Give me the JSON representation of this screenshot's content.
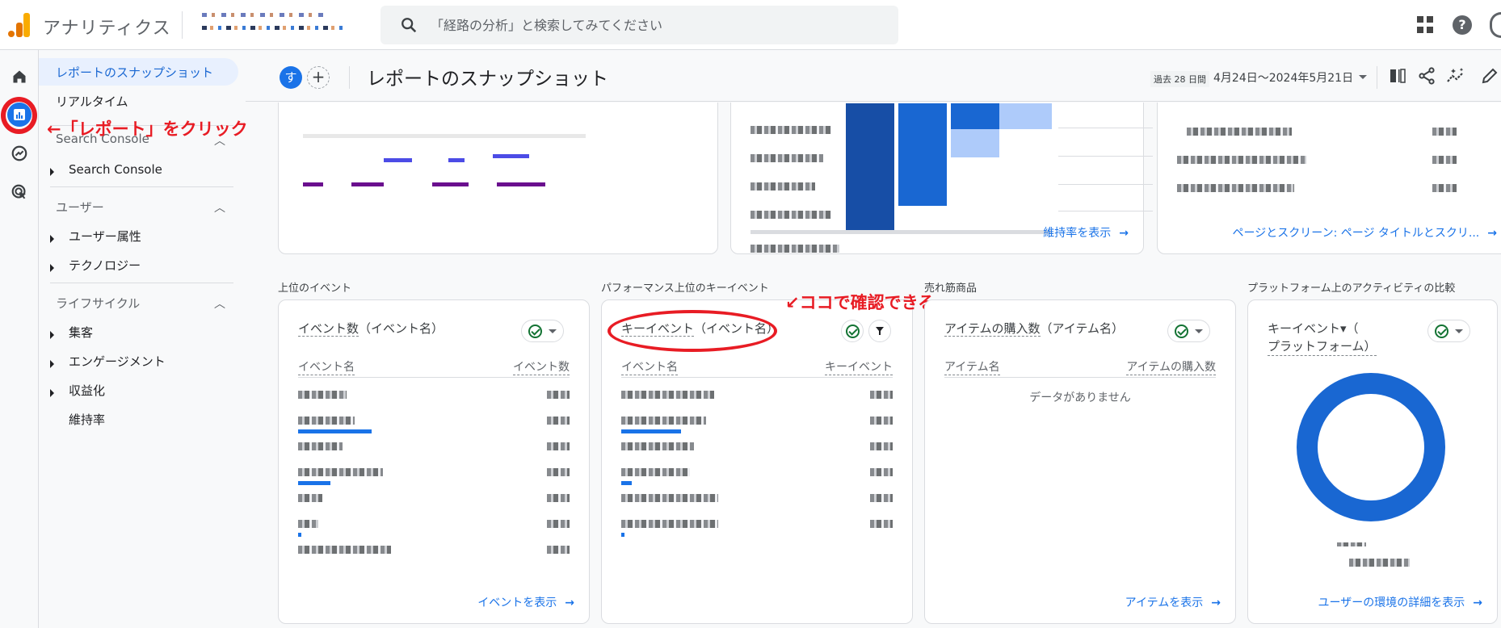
{
  "header": {
    "app_name": "アナリティクス",
    "search_placeholder": "「経路の分析」と検索してみてください",
    "icons": [
      "apps-icon",
      "help-icon",
      "account-icon"
    ]
  },
  "rail": {
    "items": [
      {
        "name": "home",
        "icon": "home-icon"
      },
      {
        "name": "reports",
        "icon": "bar-chart-icon",
        "active": true
      },
      {
        "name": "explore",
        "icon": "explore-icon"
      },
      {
        "name": "advertising",
        "icon": "target-cursor-icon"
      }
    ]
  },
  "sidenav": {
    "snapshot": "レポートのスナップショット",
    "realtime": "リアルタイム",
    "groups": [
      {
        "title": "Search Console",
        "items": [
          "Search Console"
        ]
      },
      {
        "title": "ユーザー",
        "items": [
          "ユーザー属性",
          "テクノロジー"
        ]
      },
      {
        "title": "ライフサイクル",
        "items": [
          "集客",
          "エンゲージメント",
          "収益化",
          "維持率"
        ]
      }
    ]
  },
  "annotations": {
    "report_click": "←「レポート」をクリック",
    "check_here": "↙ココで確認できる"
  },
  "page_header": {
    "segment_badge": "す",
    "add_segment": "+",
    "title": "レポートのスナップショット",
    "date_preset": "過去 28 日間",
    "date_range": "4月24日～2024年5月21日",
    "actions": [
      "compare-icon",
      "share-icon",
      "insights-icon",
      "edit-icon"
    ]
  },
  "top_cards": {
    "retention_link": "維持率を表示",
    "pages_link": "ページとスクリーン: ページ タイトルとスクリ..."
  },
  "sections": {
    "top_events": {
      "label": "上位のイベント",
      "title_metric": "イベント数",
      "title_dim": "（イベント名）",
      "col_left": "イベント名",
      "col_right": "イベント数",
      "row_bars": [
        0,
        0.27,
        0,
        0.12,
        0,
        0.01,
        0
      ],
      "link": "イベントを表示"
    },
    "key_events": {
      "label": "パフォーマンス上位のキーイベント",
      "title_metric": "キーイベント",
      "title_dim": "（イベント名）",
      "col_left": "イベント名",
      "col_right": "キーイベント",
      "row_bars": [
        0,
        0.22,
        0,
        0.04,
        0,
        0.01
      ],
      "link": ""
    },
    "top_items": {
      "label": "売れ筋商品",
      "title_metric": "アイテムの購入数",
      "title_dim": "（アイテム名）",
      "col_left": "アイテム名",
      "col_right": "アイテムの購入数",
      "empty": "データがありません",
      "link": "アイテムを表示"
    },
    "platform": {
      "label": "プラットフォーム上のアクティビティの比較",
      "title_line1": "キーイベント▾（",
      "title_line2": "プラットフォーム）",
      "donut_share": 1.0,
      "link": "ユーザーの環境の詳細を表示"
    }
  },
  "colors": {
    "accent": "#1a73e8",
    "annotation": "#e81c24",
    "check": "#137333"
  }
}
